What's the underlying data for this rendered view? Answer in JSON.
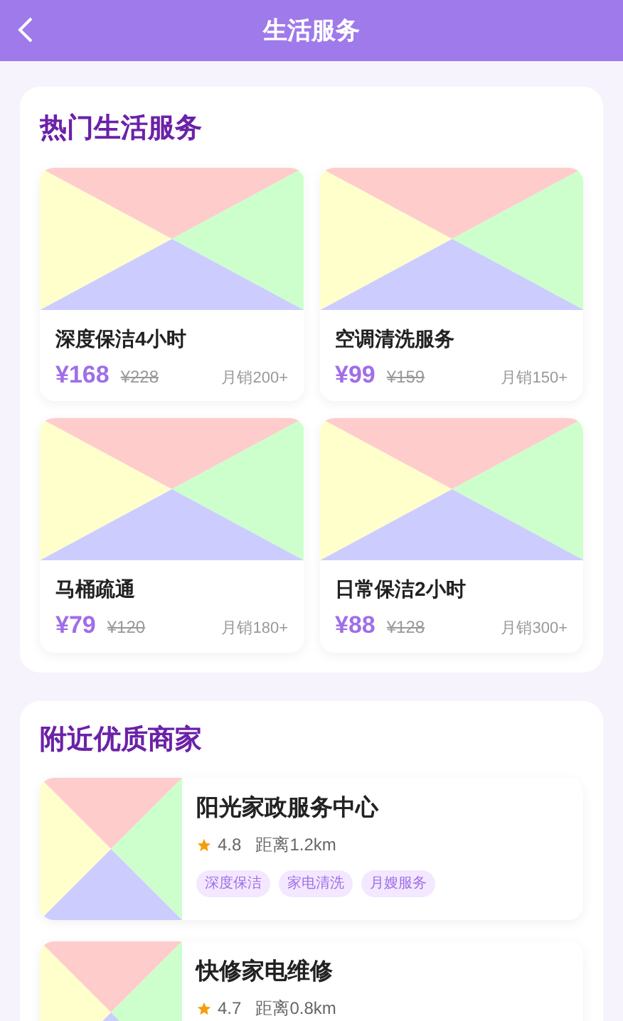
{
  "header": {
    "title": "生活服务"
  },
  "hot_services": {
    "title": "热门生活服务",
    "items": [
      {
        "name": "深度保洁4小时",
        "price": "¥168",
        "original_price": "¥228",
        "sales": "月销200+"
      },
      {
        "name": "空调清洗服务",
        "price": "¥99",
        "original_price": "¥159",
        "sales": "月销150+"
      },
      {
        "name": "马桶疏通",
        "price": "¥79",
        "original_price": "¥120",
        "sales": "月销180+"
      },
      {
        "name": "日常保洁2小时",
        "price": "¥88",
        "original_price": "¥128",
        "sales": "月销300+"
      }
    ]
  },
  "nearby_merchants": {
    "title": "附近优质商家",
    "items": [
      {
        "name": "阳光家政服务中心",
        "rating": "4.8",
        "distance": "距离1.2km",
        "tags": [
          "深度保洁",
          "家电清洗",
          "月嫂服务"
        ]
      },
      {
        "name": "快修家电维修",
        "rating": "4.7",
        "distance": "距离0.8km"
      }
    ]
  }
}
